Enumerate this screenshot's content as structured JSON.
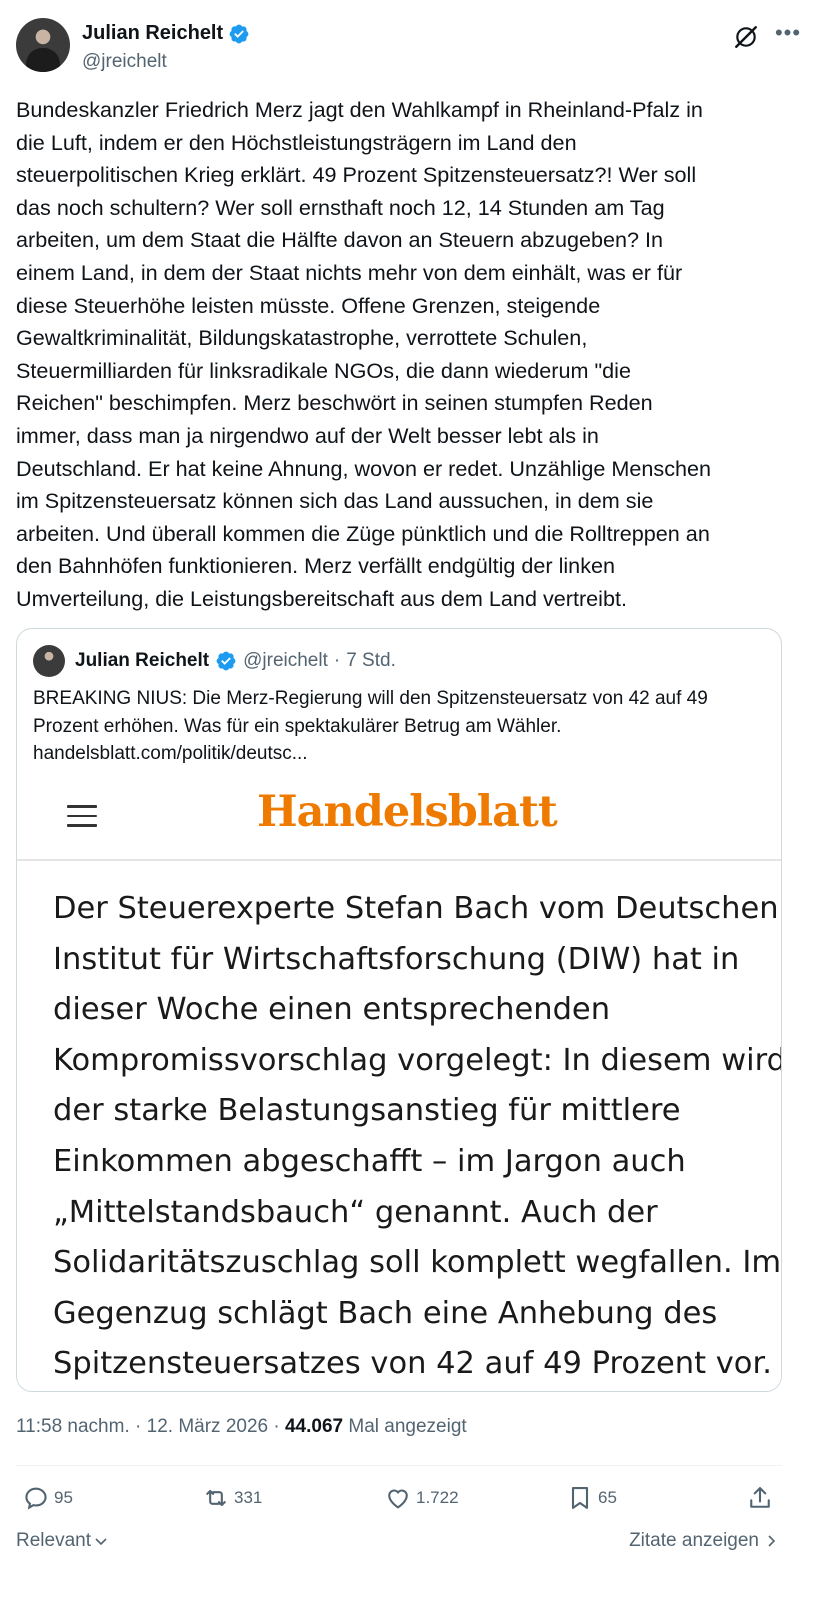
{
  "author": {
    "name": "Julian Reichelt",
    "handle": "@jreichelt"
  },
  "tweet": {
    "text": "Bundeskanzler Friedrich Merz jagt den Wahlkampf in Rheinland-Pfalz in\ndie Luft, indem er den Höchstleistungsträgern im Land den\nsteuerpolitischen Krieg erklärt. 49 Prozent Spitzensteuersatz?! Wer soll\ndas noch schultern? Wer soll ernsthaft noch 12, 14 Stunden am Tag\narbeiten, um dem Staat die Hälfte davon an Steuern abzugeben? In\neinem Land, in dem der Staat nichts mehr von dem einhält, was er für\ndiese Steuerhöhe leisten müsste. Offene Grenzen, steigende\nGewaltkriminalität, Bildungskatastrophe, verrottete Schulen,\nSteuermilliarden für linksradikale NGOs, die dann wiederum \"die\nReichen\" beschimpfen. Merz beschwört in seinen stumpfen Reden\nimmer, dass man ja nirgendwo auf der Welt besser lebt als in\nDeutschland. Er hat keine Ahnung, wovon er redet. Unzählige Menschen\nim Spitzensteuersatz können sich das Land aussuchen, in dem sie\narbeiten. Und überall kommen die Züge pünktlich und die Rolltreppen an\nden Bahnhöfen funktionieren. Merz verfällt endgültig der linken\nUmverteilung, die Leistungsbereitschaft aus dem Land vertreibt."
  },
  "quote": {
    "name": "Julian Reichelt",
    "handle": "@jreichelt",
    "separator": "·",
    "time": "7 Std.",
    "lines": [
      "BREAKING NIUS: Die Merz-Regierung will den Spitzensteuersatz von 42 auf 49",
      "Prozent erhöhen. Was für ein spektakulärer Betrug am Wähler.",
      "handelsblatt.com/politik/deutsc..."
    ],
    "article": {
      "brand": "Handelsblatt",
      "lines": [
        "Der Steuerexperte Stefan Bach vom Deutschen",
        "Institut für Wirtschaftsforschung (DIW) hat in",
        "dieser Woche einen entsprechenden",
        "Kompromissvorschlag vorgelegt: In diesem wird",
        "der starke Belastungsanstieg für mittlere",
        "Einkommen abgeschafft – im Jargon auch",
        "„Mittelstandsbauch“ genannt. Auch der",
        "Solidaritätszuschlag soll komplett wegfallen. Im",
        "Gegenzug schlägt Bach eine Anhebung des",
        "Spitzensteuersatzes von 42 auf 49 Prozent vor."
      ]
    }
  },
  "meta": {
    "time": "11:58 nachm.",
    "sep1": " · ",
    "date": "12. März 2026",
    "sep2": " · ",
    "views": "44.067",
    "views_label": " Mal angezeigt"
  },
  "actions": {
    "replies": "95",
    "reposts": "331",
    "likes": "1.722",
    "bookmarks": "65"
  },
  "footer": {
    "relevance": "Relevant",
    "quotes_link": "Zitate anzeigen"
  },
  "colors": {
    "text": "#0f1419",
    "secondary": "#536471",
    "verified": "#1d9bf0",
    "brand_orange": "#ee7a00"
  },
  "icons": [
    "verified-icon",
    "grok-icon",
    "more-icon",
    "menu-icon",
    "reply-icon",
    "repost-icon",
    "like-icon",
    "bookmark-icon",
    "share-icon",
    "chevron-down-icon",
    "chevron-right-icon"
  ]
}
